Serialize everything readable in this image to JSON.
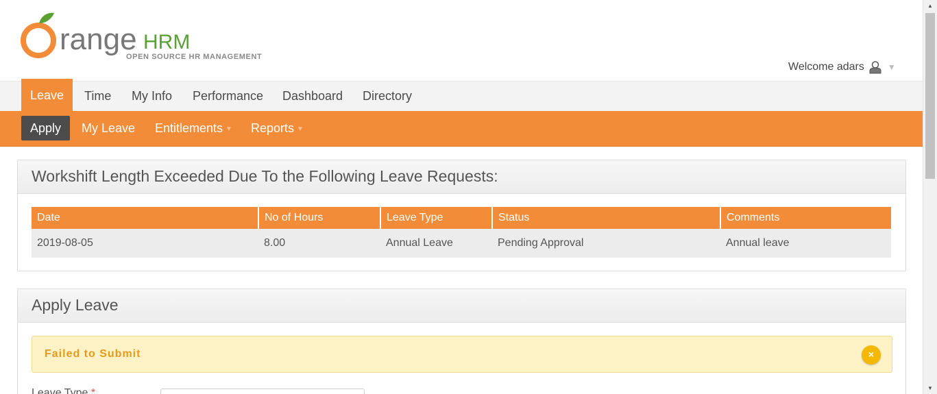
{
  "header": {
    "brand_word": "range",
    "brand_suffix": "HRM",
    "tagline": "OPEN SOURCE HR MANAGEMENT",
    "welcome_text": "Welcome adars",
    "welcome_caret": "▼"
  },
  "main_nav": {
    "items": [
      {
        "label": "Leave",
        "active": true
      },
      {
        "label": "Time"
      },
      {
        "label": "My Info"
      },
      {
        "label": "Performance"
      },
      {
        "label": "Dashboard"
      },
      {
        "label": "Directory"
      }
    ]
  },
  "sub_nav": {
    "items": [
      {
        "label": "Apply",
        "active": true
      },
      {
        "label": "My Leave"
      },
      {
        "label": "Entitlements",
        "arrow": "▼"
      },
      {
        "label": "Reports",
        "arrow": "▼"
      }
    ]
  },
  "workshift_box": {
    "title": "Workshift Length Exceeded Due To the Following Leave Requests:",
    "columns": [
      "Date",
      "No of Hours",
      "Leave Type",
      "Status",
      "Comments"
    ],
    "rows": [
      [
        "2019-08-05",
        "8.00",
        "Annual Leave",
        "Pending Approval",
        "Annual leave"
      ]
    ]
  },
  "apply_box": {
    "title": "Apply Leave",
    "alert_text": "Failed to Submit",
    "alert_close": "×",
    "leave_type_label": "Leave Type",
    "required_marker": "*"
  },
  "colors": {
    "accent": "#f28c38",
    "active_subnav": "#4c4c4c",
    "alert_bg": "#fdf2c5",
    "alert_text": "#e59a1e"
  },
  "scrollbar": {
    "up": "▲",
    "down": "▼"
  }
}
